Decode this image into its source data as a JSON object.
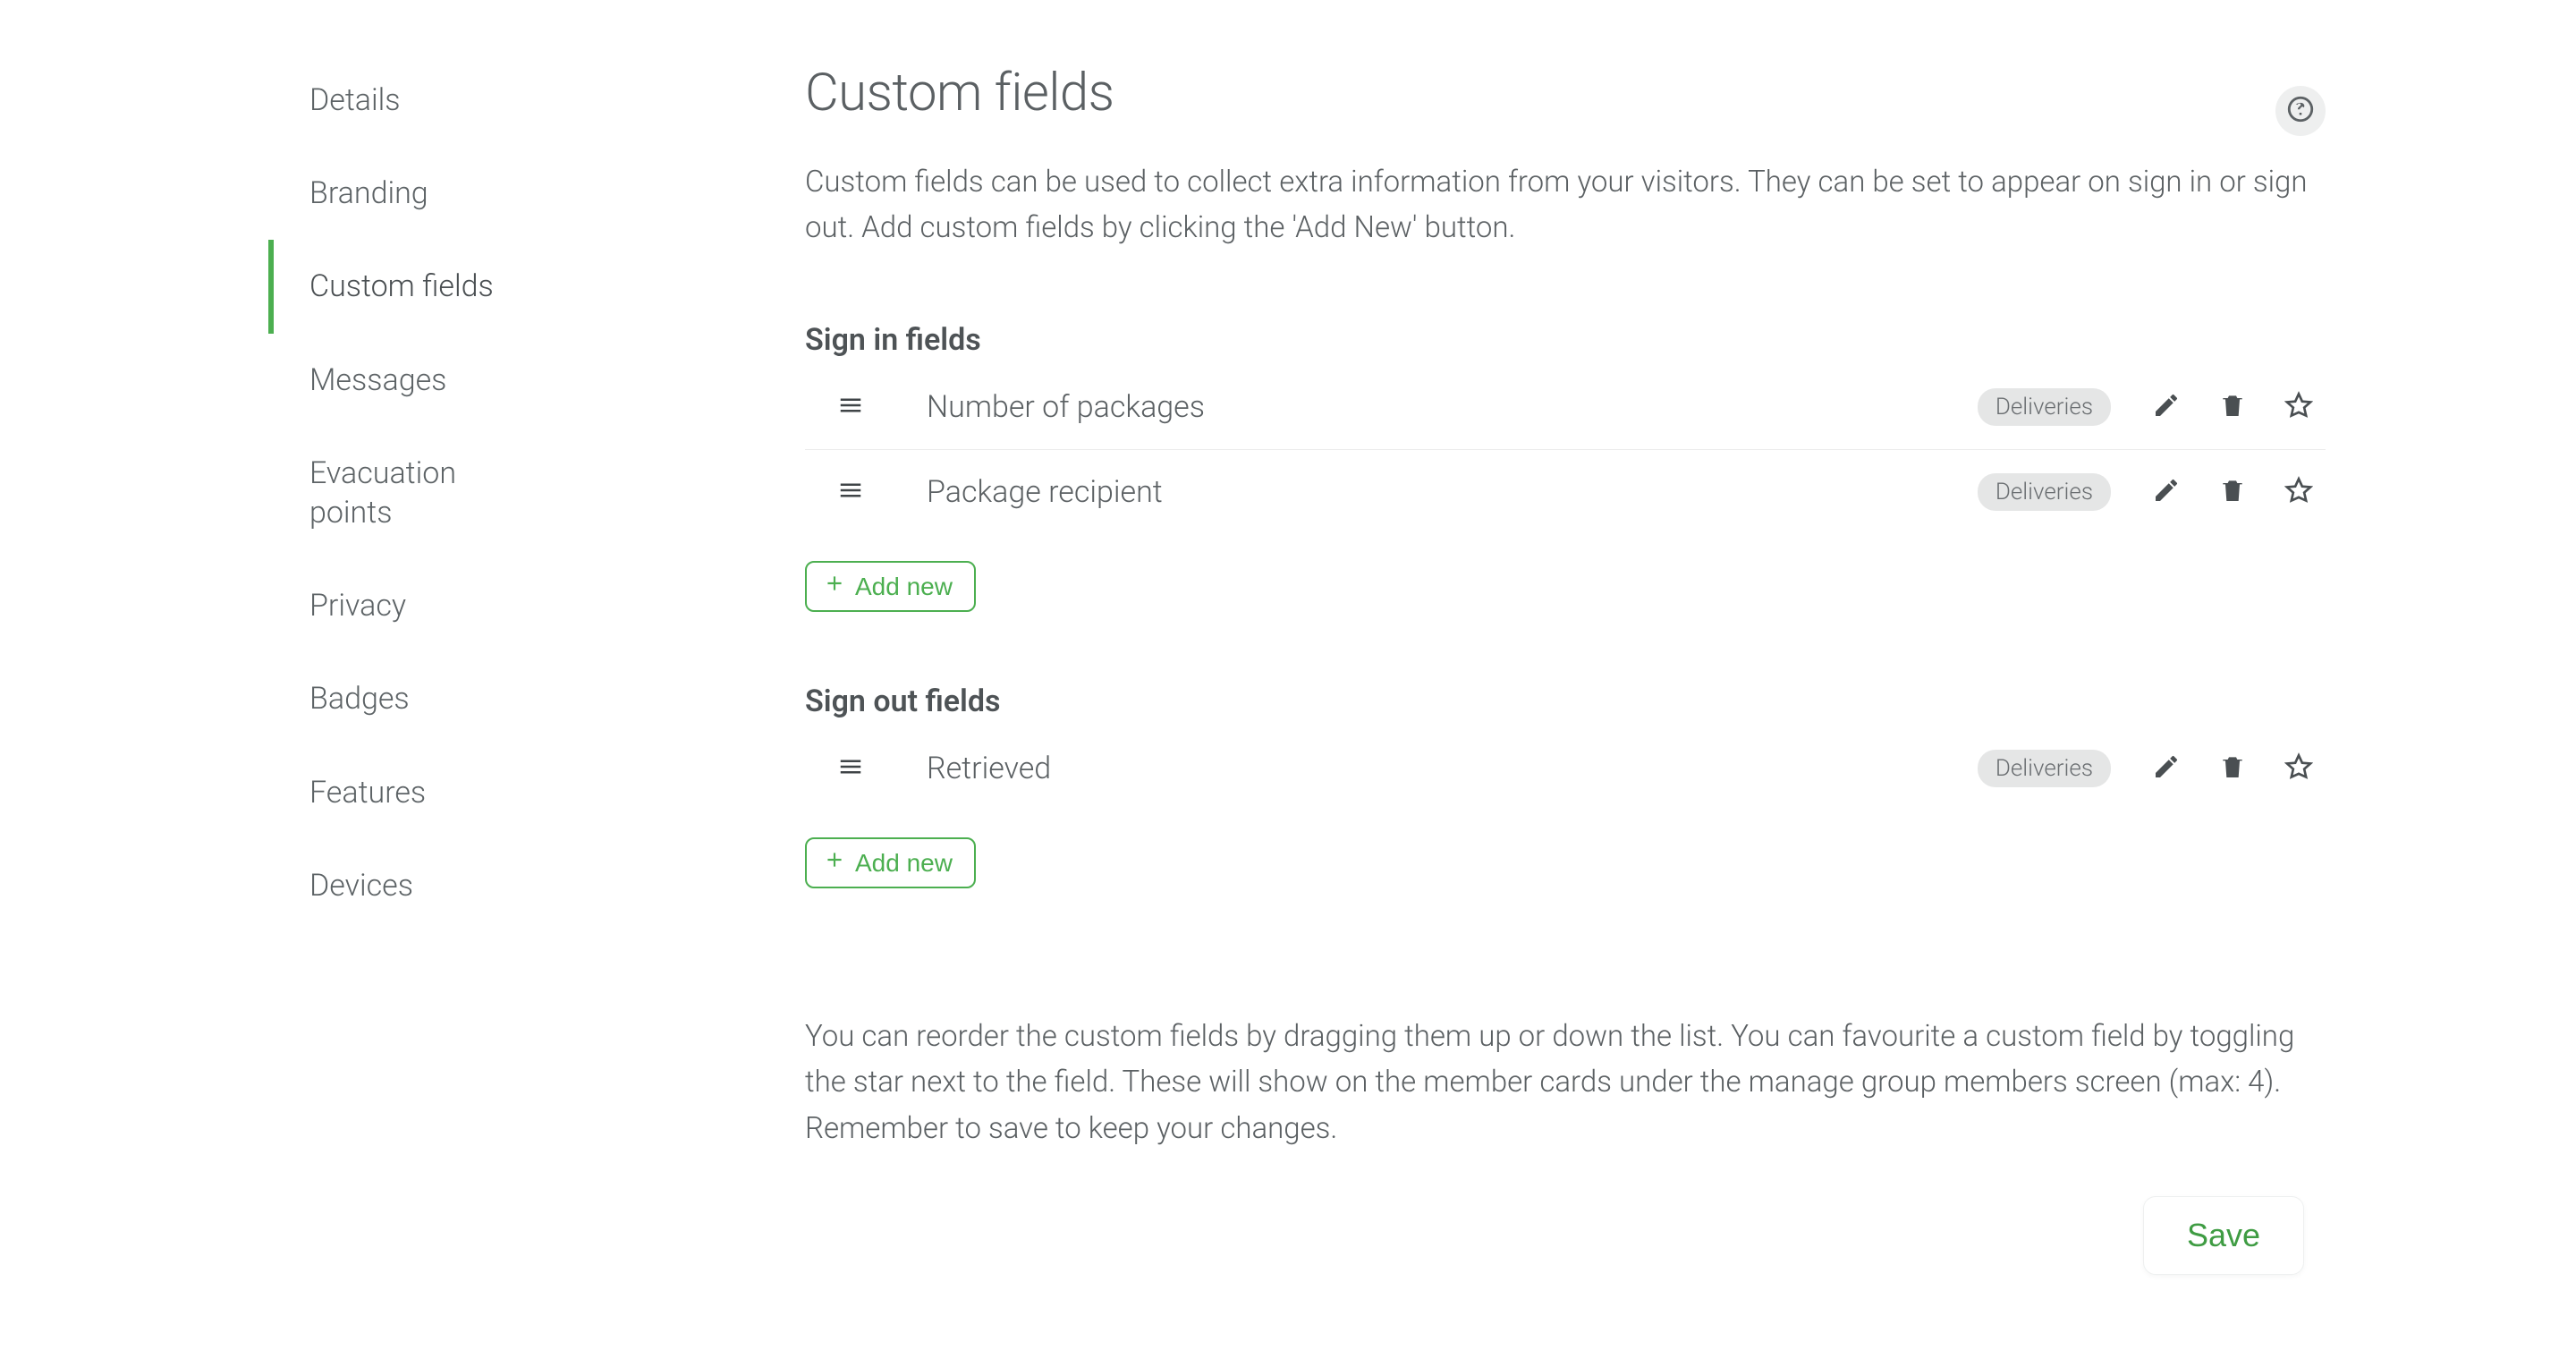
{
  "sidebar": {
    "items": [
      {
        "label": "Details"
      },
      {
        "label": "Branding"
      },
      {
        "label": "Custom fields"
      },
      {
        "label": "Messages"
      },
      {
        "label": "Evacuation points"
      },
      {
        "label": "Privacy"
      },
      {
        "label": "Badges"
      },
      {
        "label": "Features"
      },
      {
        "label": "Devices"
      }
    ],
    "activeIndex": 2
  },
  "page": {
    "title": "Custom fields",
    "intro": "Custom fields can be used to collect extra information from your visitors. They can be set to appear on sign in or sign out. Add custom fields by clicking the 'Add New' button.",
    "footer_note": "You can reorder the custom fields by dragging them up or down the list. You can favourite a custom field by toggling the star next to the field. These will show on the member cards under the manage group members screen (max: 4). Remember to save to keep your changes."
  },
  "sections": {
    "sign_in": {
      "heading": "Sign in fields",
      "fields": [
        {
          "name": "Number of packages",
          "tag": "Deliveries"
        },
        {
          "name": "Package recipient",
          "tag": "Deliveries"
        }
      ],
      "add_label": "Add new"
    },
    "sign_out": {
      "heading": "Sign out fields",
      "fields": [
        {
          "name": "Retrieved",
          "tag": "Deliveries"
        }
      ],
      "add_label": "Add new"
    }
  },
  "buttons": {
    "save": "Save"
  }
}
